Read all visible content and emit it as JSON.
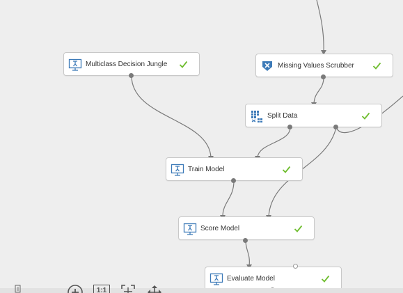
{
  "experiment_canvas": {
    "modules": [
      {
        "id": "multiclass-decision-jungle",
        "label": "Multiclass Decision Jungle",
        "icon": "learner-icon",
        "status": "completed"
      },
      {
        "id": "missing-values-scrubber",
        "label": "Missing Values Scrubber",
        "icon": "scrubber-icon",
        "status": "completed"
      },
      {
        "id": "split-data",
        "label": "Split Data",
        "icon": "split-data-icon",
        "status": "completed"
      },
      {
        "id": "train-model",
        "label": "Train Model",
        "icon": "learner-icon",
        "status": "completed"
      },
      {
        "id": "score-model",
        "label": "Score Model",
        "icon": "learner-icon",
        "status": "completed"
      },
      {
        "id": "evaluate-model",
        "label": "Evaluate Model",
        "icon": "learner-icon",
        "status": "completed"
      }
    ],
    "connections": [
      [
        "multiclass-decision-jungle",
        "train-model"
      ],
      [
        "missing-values-scrubber",
        "split-data"
      ],
      [
        "split-data",
        "train-model"
      ],
      [
        "split-data",
        "score-model"
      ],
      [
        "train-model",
        "score-model"
      ],
      [
        "score-model",
        "evaluate-model"
      ]
    ]
  },
  "zoom_toolbar": {
    "actual_size_label": "1:1",
    "tools": [
      "minimap-icon",
      "zoom-in-icon",
      "actual-size-icon",
      "fit-to-screen-icon",
      "pan-icon"
    ]
  },
  "colors": {
    "canvas_background": "#eeeeee",
    "module_background": "#ffffff",
    "module_border": "#c8c8c8",
    "wire": "#7a7a7a",
    "success_check": "#6fbd2f",
    "icon_blue": "#3c7ab8"
  }
}
